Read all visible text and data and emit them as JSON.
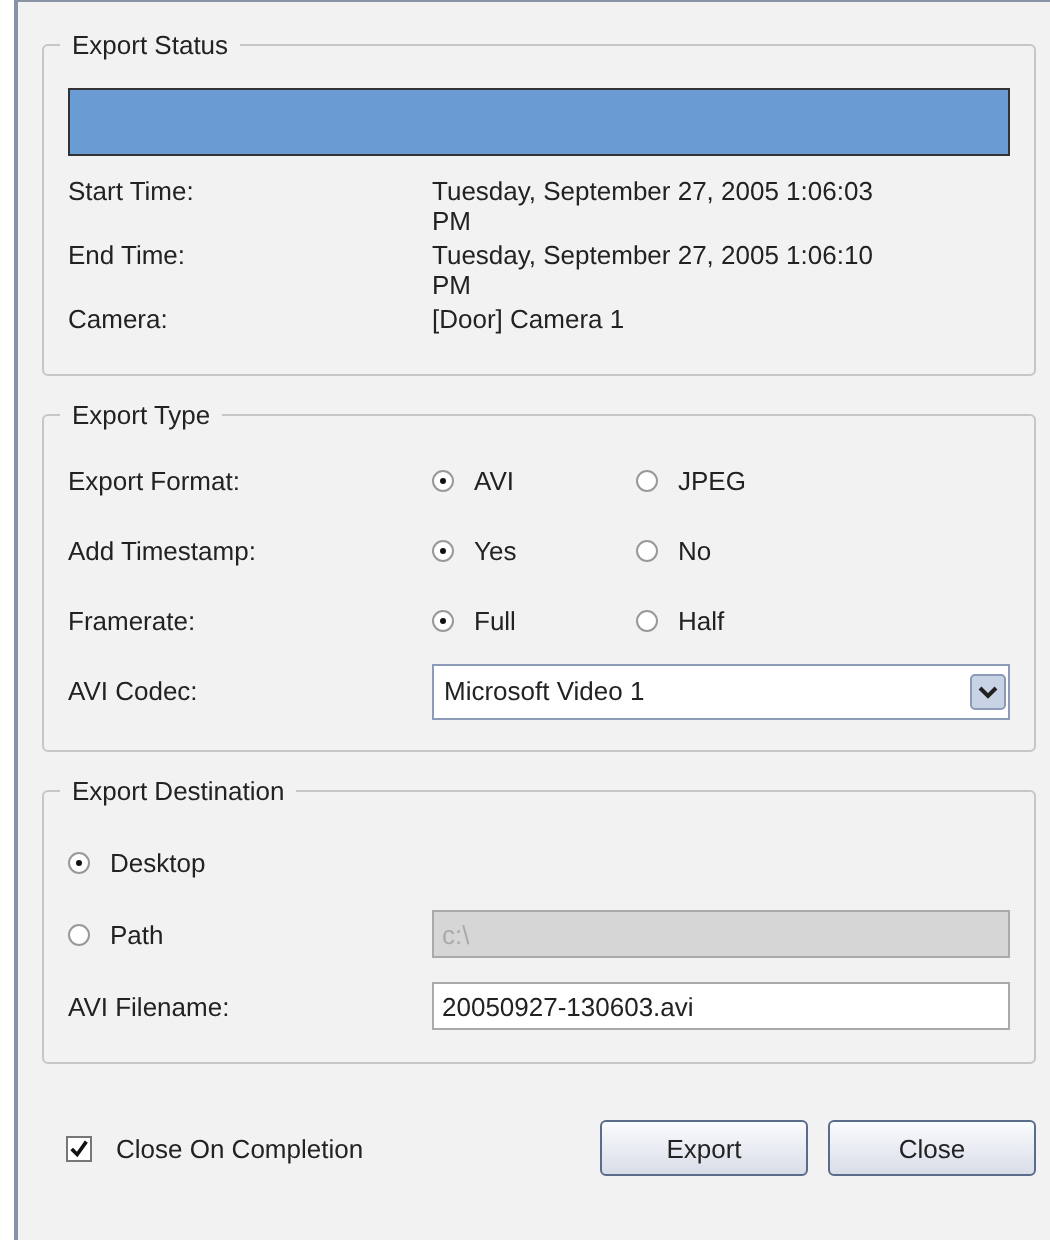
{
  "export_status": {
    "title": "Export Status",
    "progress": {
      "level": 1
    },
    "rows": [
      {
        "label": "Start Time:",
        "value": "Tuesday, September 27, 2005 1:06:03 PM"
      },
      {
        "label": "End Time:",
        "value": "Tuesday, September 27, 2005 1:06:10 PM"
      },
      {
        "label": "Camera:",
        "value": "[Door] Camera 1"
      }
    ]
  },
  "export_type": {
    "title": "Export Type",
    "options": [
      {
        "label": "Export Format:",
        "choices": [
          {
            "label": "AVI",
            "selected": true
          },
          {
            "label": "JPEG",
            "selected": false
          }
        ]
      },
      {
        "label": "Add Timestamp:",
        "choices": [
          {
            "label": "Yes",
            "selected": true
          },
          {
            "label": "No",
            "selected": false
          }
        ]
      },
      {
        "label": "Framerate:",
        "choices": [
          {
            "label": "Full",
            "selected": true
          },
          {
            "label": "Half",
            "selected": false
          }
        ]
      }
    ],
    "codec": {
      "label": "AVI Codec:",
      "value": "Microsoft Video 1"
    }
  },
  "export_destination": {
    "title": "Export Destination",
    "choices": [
      {
        "label": "Desktop",
        "selected": true
      },
      {
        "label": "Path",
        "selected": false
      }
    ],
    "path_field": {
      "value": "c:\\",
      "disabled": true
    },
    "filename": {
      "label": "AVI Filename:",
      "value": "20050927-130603.avi"
    }
  },
  "close_on_completion": {
    "label": "Close On Completion",
    "checked": true
  },
  "buttons": [
    "Export",
    "Close"
  ]
}
